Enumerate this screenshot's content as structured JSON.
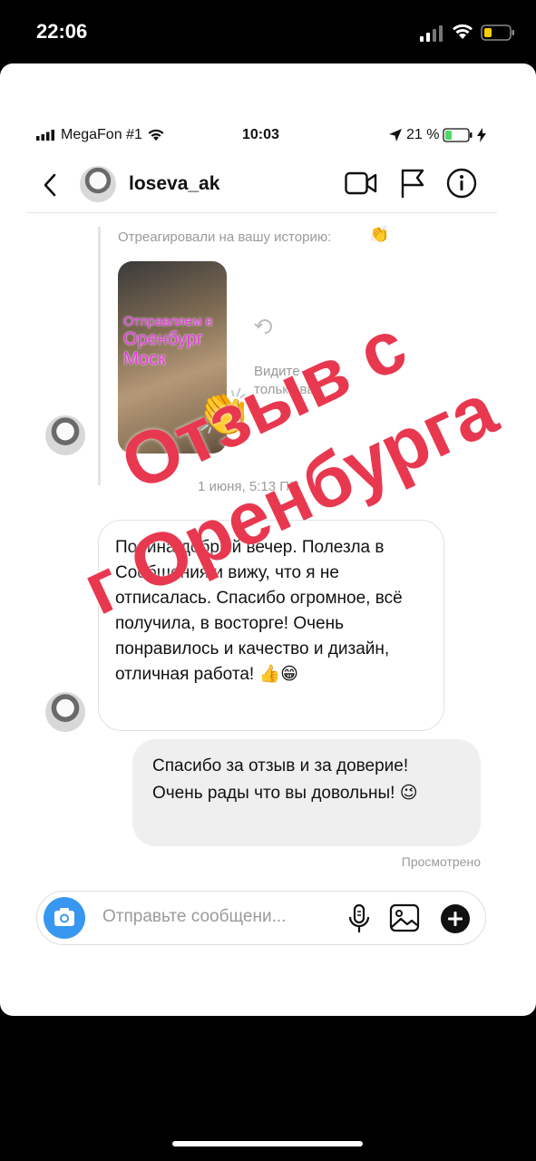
{
  "device_status": {
    "time": "22:06",
    "battery_color": "#f5d000"
  },
  "inner_status": {
    "carrier": "MegaFon #1",
    "time": "10:03",
    "battery": "21 %",
    "battery_color": "#4cd964"
  },
  "header": {
    "username": "loseva_ak"
  },
  "reaction": {
    "label": "Отреагировали на вашу историю:",
    "emoji": "👏",
    "big_emoji": "👏",
    "story_text_line1": "Отправляем в",
    "story_text_line2": "Оренбург",
    "story_text_line3": "Моск",
    "visibility_note_line1": "Видите",
    "visibility_note_line2": "только вы",
    "timestamp": "1 июня, 5:13 ПП"
  },
  "messages": [
    {
      "direction": "incoming",
      "text": "Полина добрый вечер. Полезла в Сообщения и вижу, что я не отписалась. Спасибо огромное, всё получила, в восторге! Очень понравилось и качество и дизайн, отличная работа! 👍😁"
    },
    {
      "direction": "outgoing",
      "text": "Спасибо за отзыв и за доверие! Очень рады что вы довольны! 😉"
    }
  ],
  "seen_label": "Просмотрено",
  "composer": {
    "placeholder": "Отправьте сообщени..."
  },
  "overlay": {
    "line1": "Отзыв с",
    "line2": "г Оренбурга",
    "color": "#e8384f"
  },
  "icons": [
    "signal-icon",
    "wifi-icon",
    "battery-icon",
    "back-icon",
    "video-call-icon",
    "flag-icon",
    "info-icon",
    "refresh-icon",
    "camera-icon",
    "mic-icon",
    "gallery-icon",
    "plus-icon"
  ]
}
